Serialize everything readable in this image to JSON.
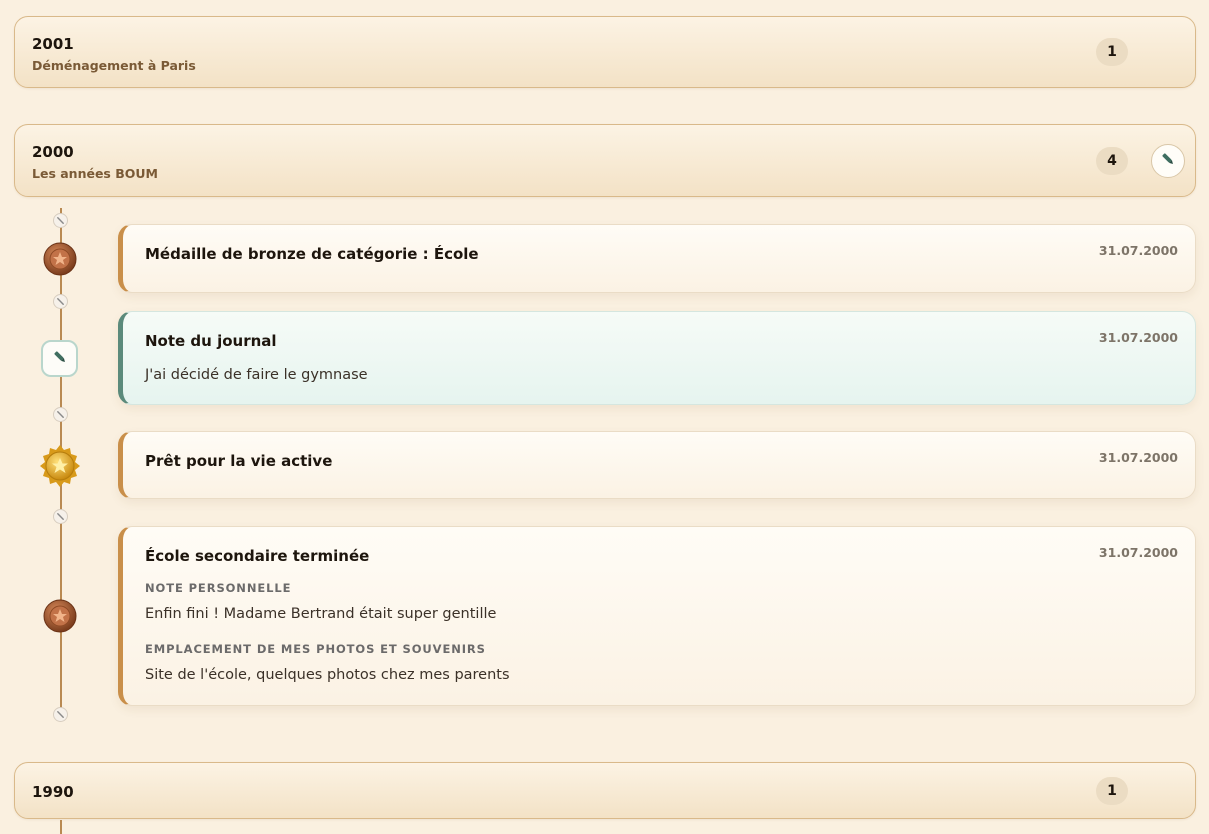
{
  "years": [
    {
      "year": "2001",
      "subtitle": "Déménagement à Paris",
      "count": "1"
    },
    {
      "year": "2000",
      "subtitle": "Les années BOUM",
      "count": "4"
    },
    {
      "year": "1990",
      "count": "1"
    }
  ],
  "events": [
    {
      "title": "Médaille de bronze de catégorie : École",
      "date": "31.07.2000",
      "icon": "bronze-medal-icon"
    },
    {
      "title": "Note du journal",
      "date": "31.07.2000",
      "text": "J'ai décidé de faire le gymnase",
      "icon": "pencil-icon"
    },
    {
      "title": "Prêt pour la vie active",
      "date": "31.07.2000",
      "icon": "gold-medal-icon"
    },
    {
      "title": "École secondaire terminée",
      "date": "31.07.2000",
      "icon": "bronze-medal-icon",
      "label1": "NOTE PERSONNELLE",
      "text1": "Enfin fini ! Madame Bertrand était super gentille",
      "label2": "EMPLACEMENT DE MES PHOTOS ET SOUVENIRS",
      "text2": "Site de l'école, quelques photos chez mes parents"
    }
  ],
  "colors": {
    "background": "#faf0e0",
    "accent": "#c98f4a",
    "journal_accent": "#5b8a7b",
    "bronze": "#a0532a",
    "gold": "#e0a41e"
  }
}
